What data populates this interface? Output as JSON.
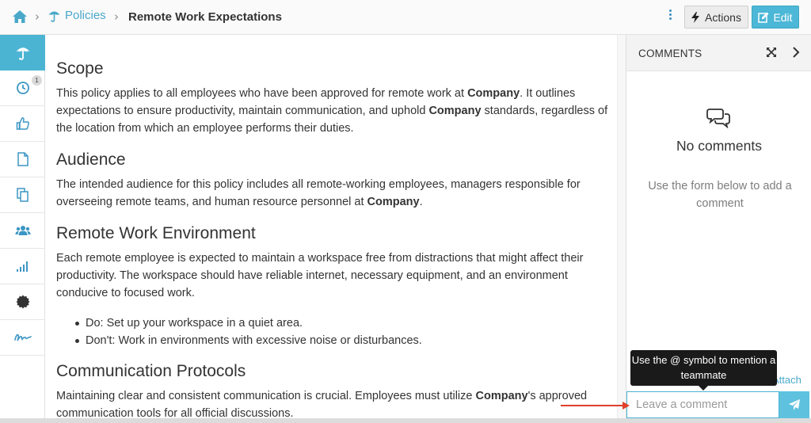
{
  "breadcrumb": {
    "home_icon": "home-icon",
    "section_icon": "umbrella-icon",
    "section": "Policies",
    "current": "Remote Work Expectations",
    "separator": "›"
  },
  "toolbar": {
    "more_icon": "vertical-dots-icon",
    "actions_label": "Actions",
    "actions_icon": "bolt-icon",
    "edit_label": "Edit",
    "edit_icon": "edit-icon"
  },
  "sidebar": {
    "items": [
      {
        "icon": "umbrella-icon",
        "active": true
      },
      {
        "icon": "clock-icon",
        "badge": "1"
      },
      {
        "icon": "thumbs-up-icon"
      },
      {
        "icon": "document-icon"
      },
      {
        "icon": "copy-icon"
      },
      {
        "icon": "users-icon"
      },
      {
        "icon": "signal-bars-icon"
      },
      {
        "icon": "seal-icon"
      },
      {
        "icon": "signature-icon"
      }
    ]
  },
  "document": {
    "scope_heading": "Scope",
    "scope_text_1": "This policy applies to all employees who have been approved for remote work at ",
    "company": "Company",
    "scope_text_2": ". It outlines expectations to ensure productivity, maintain communication, and uphold ",
    "scope_text_3": " standards, regardless of the location from which an employee performs their duties.",
    "audience_heading": "Audience",
    "audience_text_1": "The intended audience for this policy includes all remote-working employees, managers responsible for overseeing remote teams, and human resource personnel at ",
    "audience_text_2": ".",
    "environment_heading": "Remote Work Environment",
    "environment_text": "Each remote employee is expected to maintain a workspace free from distractions that might affect their productivity. The workspace should have reliable internet, necessary equipment, and an environment conducive to focused work.",
    "bullets": [
      "Do: Set up your workspace in a quiet area.",
      "Don't: Work in environments with excessive noise or disturbances."
    ],
    "communication_heading": "Communication Protocols",
    "communication_text_1": "Maintaining clear and consistent communication is crucial. Employees must utilize ",
    "communication_text_2": "'s approved communication tools for all official discussions."
  },
  "comments": {
    "title": "COMMENTS",
    "empty_title": "No comments",
    "empty_hint": "Use the form below to add a comment",
    "tooltip": "Use the @ symbol to mention a teammate",
    "attach_label": "Attach",
    "input_placeholder": "Leave a comment",
    "send_icon": "send-icon"
  },
  "colors": {
    "accent": "#4bb4d3",
    "link": "#4aa8c9",
    "arrow": "#e0402a"
  }
}
